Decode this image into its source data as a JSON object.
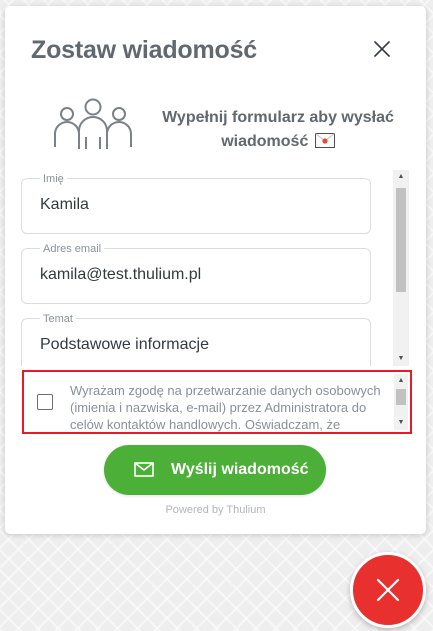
{
  "widget": {
    "title": "Zostaw wiadomość",
    "intro_line1": "Wypełnij formularz aby wysłać",
    "intro_line2": "wiadomość",
    "intro_emoji_icon": "envelope-emoji-icon",
    "people_icon": "team-people-icon",
    "close_icon": "close-icon"
  },
  "form": {
    "fields": [
      {
        "label": "Imię",
        "value": "Kamila"
      },
      {
        "label": "Adres email",
        "value": "kamila@test.thulium.pl"
      },
      {
        "label": "Temat",
        "value": "Podstawowe informacje"
      }
    ],
    "consent": {
      "checked": false,
      "text": "Wyrażam zgodę na przetwarzanie danych osobowych (imienia i nazwiska, e-mail) przez Administratora do celów kontaktów handlowych. Oświadczam, że"
    }
  },
  "send_button": {
    "label": "Wyślij wiadomość",
    "icon": "envelope-icon",
    "color": "#4caf38"
  },
  "footer": {
    "powered_by": "Powered by Thulium"
  },
  "fab": {
    "icon": "close-icon",
    "color": "#e8312e"
  },
  "colors": {
    "highlight_border": "#e8192c",
    "text_heading": "#606870"
  }
}
